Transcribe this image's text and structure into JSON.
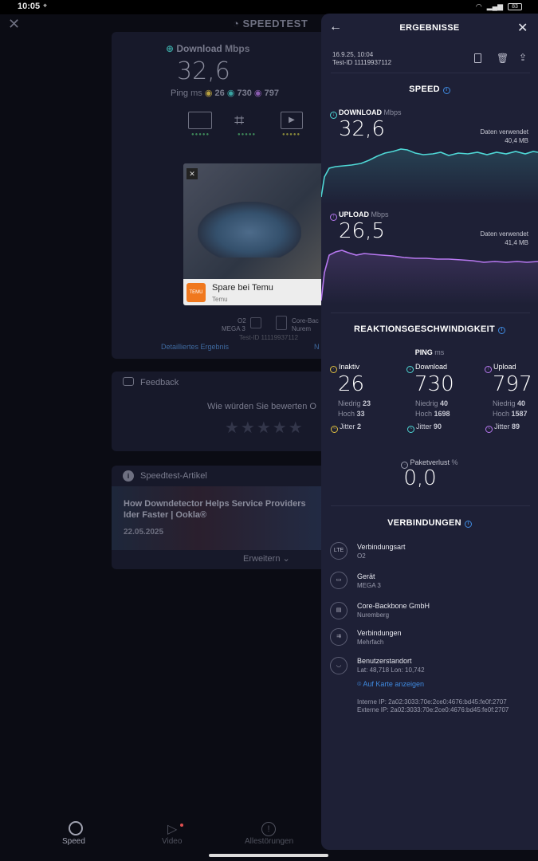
{
  "status": {
    "time": "10:05",
    "battery": "83"
  },
  "background": {
    "title": "SPEEDTEST",
    "download_label": "Download",
    "download_unit": "Mbps",
    "download_value": "32,6",
    "ping_label": "Ping",
    "ping_unit": "ms",
    "ping_idle": "26",
    "ping_dl": "730",
    "ping_ul": "797",
    "ad_text": "Spare bei Temu",
    "ad_sub": "Temu",
    "ad_logo": "TEMU",
    "server_a": "O2",
    "server_a_sub": "MEGA 3",
    "server_b": "Core-Bac",
    "server_b_sub": "Nurem",
    "test_id": "Test-ID 11119937112",
    "detail_link": "Detailliertes Ergebnis",
    "feedback_title": "Feedback",
    "feedback_question": "Wie würden Sie bewerten O",
    "article_header": "Speedtest-Artikel",
    "article_title": "How Downdetector Helps Service Providers Ider Faster | Ookla®",
    "article_date": "22.05.2025",
    "expand_label": "Erweitern",
    "nav": {
      "speed": "Speed",
      "video": "Video",
      "outages": "Allestörungen"
    }
  },
  "panel": {
    "title": "ERGEBNISSE",
    "date": "16.9.25, 10:04",
    "test_id": "Test-ID 11119937112",
    "speed_title": "SPEED",
    "download": {
      "label": "DOWNLOAD",
      "unit": "Mbps",
      "value": "32,6",
      "data_used_label": "Daten verwendet",
      "data_used": "40,4 MB"
    },
    "upload": {
      "label": "UPLOAD",
      "unit": "Mbps",
      "value": "26,5",
      "data_used_label": "Daten verwendet",
      "data_used": "41,4 MB"
    },
    "reaction_title": "REAKTIONSGESCHWINDIGKEIT",
    "ping_label": "PING",
    "ping_unit": "ms",
    "ping": [
      {
        "label": "Inaktiv",
        "value": "26",
        "low_label": "Niedrig",
        "low": "23",
        "high_label": "Hoch",
        "high": "33",
        "jitter_label": "Jitter",
        "jitter": "2"
      },
      {
        "label": "Download",
        "value": "730",
        "low_label": "Niedrig",
        "low": "40",
        "high_label": "Hoch",
        "high": "1698",
        "jitter_label": "Jitter",
        "jitter": "90"
      },
      {
        "label": "Upload",
        "value": "797",
        "low_label": "Niedrig",
        "low": "40",
        "high_label": "Hoch",
        "high": "1587",
        "jitter_label": "Jitter",
        "jitter": "89"
      }
    ],
    "packet_loss_label": "Paketverlust",
    "packet_loss_unit": "%",
    "packet_loss": "0,0",
    "connections_title": "VERBINDUNGEN",
    "connections": [
      {
        "icon": "LTE",
        "title": "Verbindungsart",
        "sub": "O2"
      },
      {
        "icon": "device",
        "title": "Gerät",
        "sub": "MEGA 3"
      },
      {
        "icon": "server",
        "title": "Core-Backbone GmbH",
        "sub": "Nuremberg"
      },
      {
        "icon": "connections",
        "title": "Verbindungen",
        "sub": "Mehrfach"
      },
      {
        "icon": "user",
        "title": "Benutzerstandort",
        "sub": "Lat: 48,718 Lon: 10,742"
      }
    ],
    "map_link": "Auf Karte anzeigen",
    "internal_ip": "Interne IP: 2a02:3033:70e:2ce0:4676:bd45:fe0f:2707",
    "external_ip": "Externe IP: 2a02:3033:70e:2ce0:4676:bd45:fe0f:2707",
    "colors": {
      "download": "#4fd8d6",
      "upload": "#b778f0",
      "accent": "#3f8ae0",
      "panel_bg": "#1e2036"
    }
  }
}
